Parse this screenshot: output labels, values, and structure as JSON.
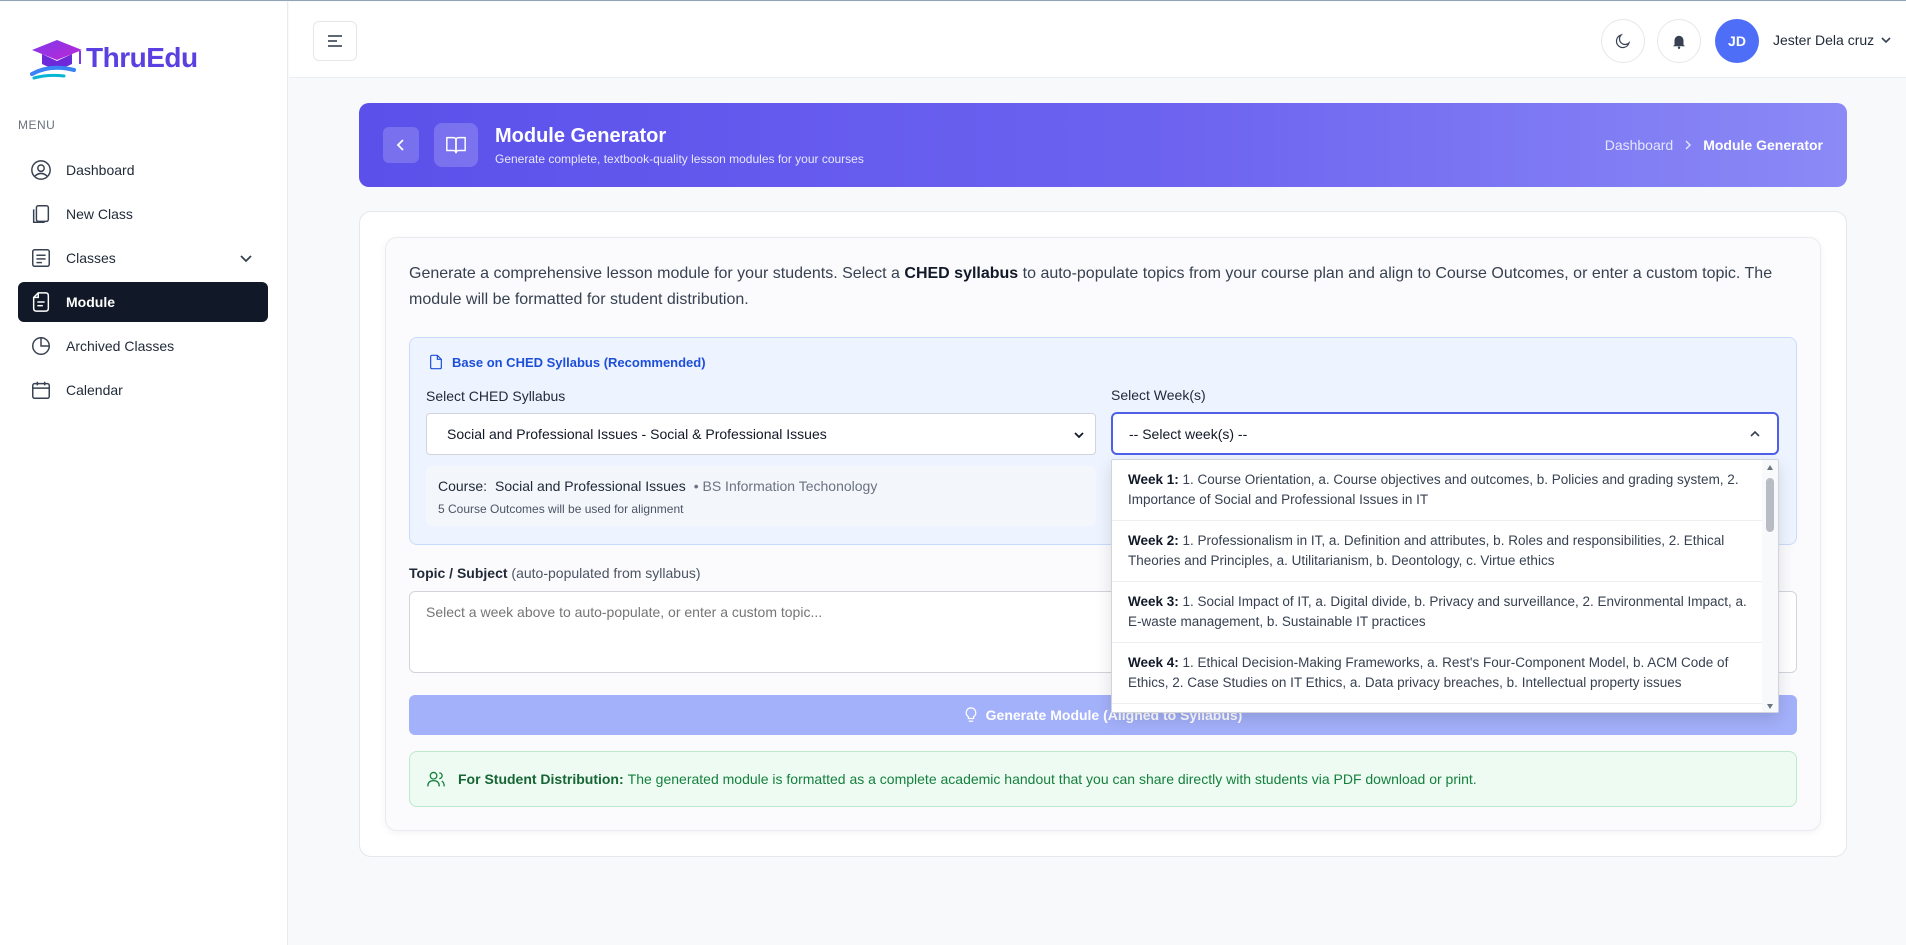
{
  "app": {
    "name": "ThruEdu"
  },
  "sidebar": {
    "menu_label": "MENU",
    "items": [
      {
        "label": "Dashboard",
        "icon": "user-circle-icon"
      },
      {
        "label": "New Class",
        "icon": "copy-icon"
      },
      {
        "label": "Classes",
        "icon": "list-icon"
      },
      {
        "label": "Module",
        "icon": "file-icon",
        "active": true
      },
      {
        "label": "Archived Classes",
        "icon": "pie-chart-icon"
      },
      {
        "label": "Calendar",
        "icon": "calendar-icon"
      }
    ]
  },
  "topbar": {
    "avatar_initials": "JD",
    "user_name": "Jester Dela cruz"
  },
  "banner": {
    "title": "Module Generator",
    "subtitle": "Generate complete, textbook-quality lesson modules for your courses",
    "breadcrumb": [
      "Dashboard",
      "Module Generator"
    ]
  },
  "intro": {
    "part1": "Generate a comprehensive lesson module for your students. Select a ",
    "bold": "CHED syllabus",
    "part2": " to auto-populate topics from your course plan and align to Course Outcomes, or enter a custom topic. The module will be formatted for student distribution."
  },
  "syllabus": {
    "heading": "Base on CHED Syllabus (Recommended)",
    "select_label": "Select CHED Syllabus",
    "selected": "Social and Professional Issues - Social & Professional Issues",
    "course_key": "Course:",
    "course_name": "Social and Professional Issues",
    "course_degree": "• BS Information Techonology",
    "outcomes_note": "5 Course Outcomes will be used for alignment"
  },
  "weeks": {
    "label": "Select Week(s)",
    "placeholder": "-- Select week(s) --",
    "options": [
      {
        "week": "Week 1:",
        "text": " 1. Course Orientation, a. Course objectives and outcomes, b. Policies and grading system, 2. Importance of Social and Professional Issues in IT"
      },
      {
        "week": "Week 2:",
        "text": " 1. Professionalism in IT, a. Definition and attributes, b. Roles and responsibilities, 2. Ethical Theories and Principles, a. Utilitarianism, b. Deontology, c. Virtue ethics"
      },
      {
        "week": "Week 3:",
        "text": " 1. Social Impact of IT, a. Digital divide, b. Privacy and surveillance, 2. Environmental Impact, a. E-waste management, b. Sustainable IT practices"
      },
      {
        "week": "Week 4:",
        "text": " 1. Ethical Decision-Making Frameworks, a. Rest's Four-Component Model, b. ACM Code of Ethics, 2. Case Studies on IT Ethics, a. Data privacy breaches, b. Intellectual property issues"
      }
    ]
  },
  "topic": {
    "label_bold": "Topic / Subject",
    "label_hint": " (auto-populated from syllabus)",
    "placeholder": "Select a week above to auto-populate, or enter a custom topic..."
  },
  "generate": {
    "label": "Generate Module (Aligned to Syllabus)"
  },
  "distribution": {
    "bold": "For Student Distribution:",
    "text": "The generated module is formatted as a complete academic handout that you can share directly with students via PDF download or print."
  },
  "colors": {
    "brand": "#5b3fe0",
    "active_nav": "#111827",
    "banner_start": "#5b50ea",
    "banner_end": "#8b8af6",
    "accent_blue": "#4f6ef7",
    "generate_disabled": "#a3b0fa"
  }
}
